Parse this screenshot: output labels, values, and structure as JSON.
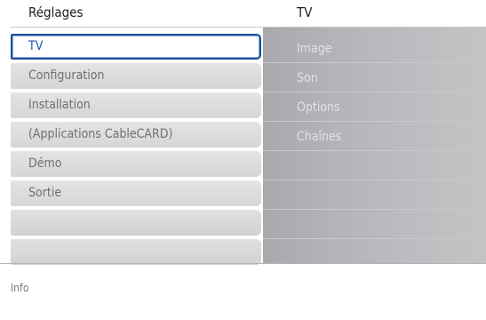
{
  "header": {
    "left_title": "Réglages",
    "right_title": "TV"
  },
  "left_menu": {
    "items": [
      {
        "label": "TV",
        "selected": true
      },
      {
        "label": "Configuration",
        "selected": false
      },
      {
        "label": "Installation",
        "selected": false
      },
      {
        "label": "(Applications CableCARD)",
        "selected": false
      },
      {
        "label": "Démo",
        "selected": false
      },
      {
        "label": "Sortie",
        "selected": false
      },
      {
        "label": "",
        "selected": false
      },
      {
        "label": "",
        "selected": false
      }
    ]
  },
  "right_menu": {
    "items": [
      {
        "label": "Image"
      },
      {
        "label": "Son"
      },
      {
        "label": "Options"
      },
      {
        "label": "Chaînes"
      },
      {
        "label": ""
      },
      {
        "label": ""
      },
      {
        "label": ""
      },
      {
        "label": ""
      }
    ]
  },
  "info": {
    "label": "Info"
  },
  "colors": {
    "selection_border": "#1f4f9a",
    "selection_text": "#1c56b8"
  }
}
